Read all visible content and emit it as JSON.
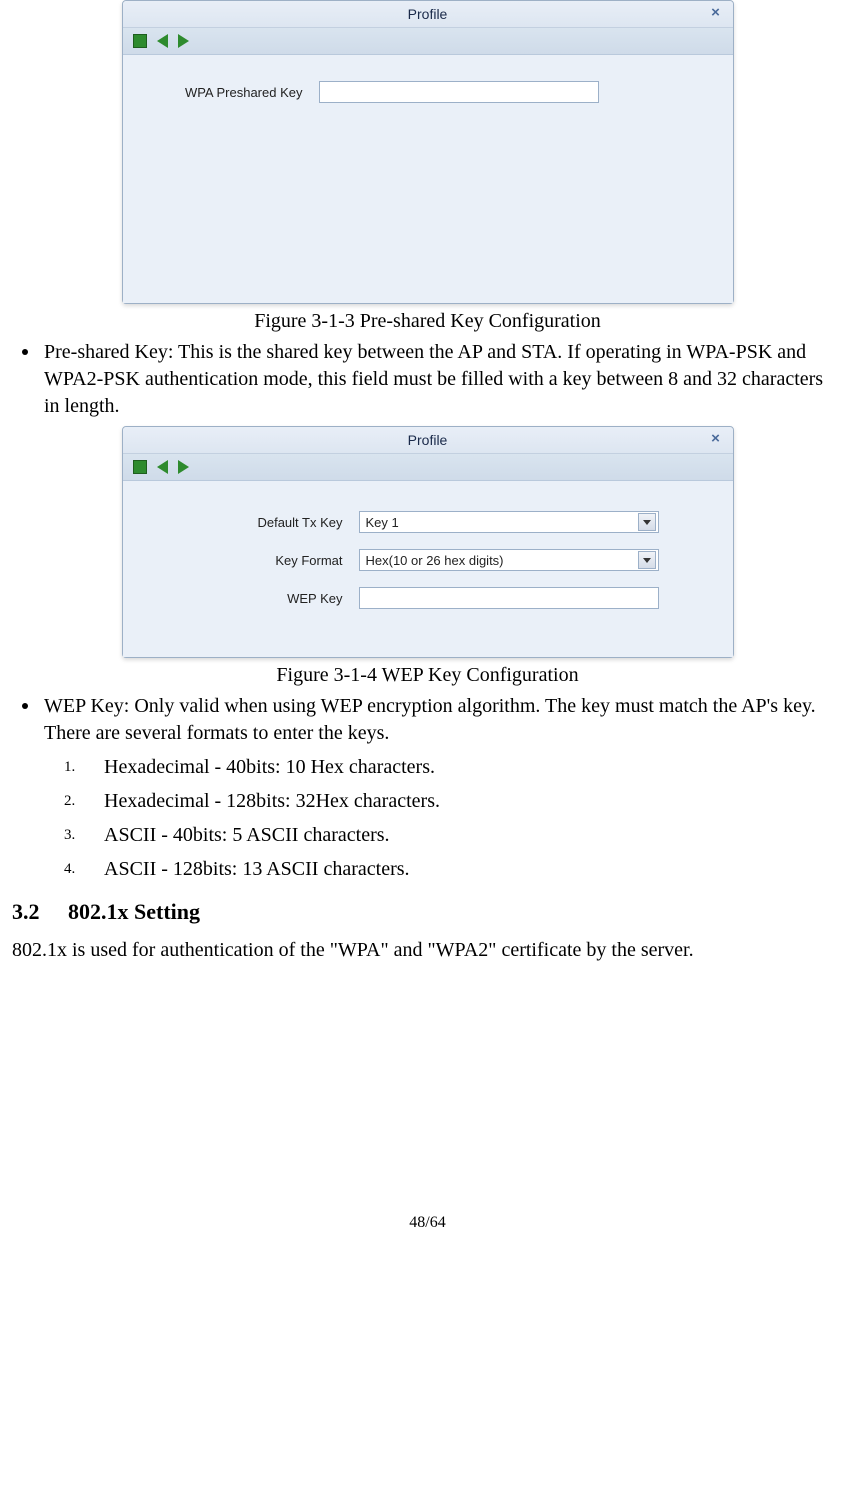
{
  "dialog1": {
    "title": "Profile",
    "field_label": "WPA Preshared Key",
    "field_value": ""
  },
  "caption1": "Figure 3-1-3 Pre-shared Key Configuration",
  "bullet1": "Pre-shared Key: This is the shared key between the AP and STA. If operating in WPA-PSK and WPA2-PSK authentication mode, this field must be filled with a key between 8 and 32 characters in length.",
  "dialog2": {
    "title": "Profile",
    "tx_label": "Default Tx Key",
    "tx_value": "Key 1",
    "fmt_label": "Key Format",
    "fmt_value": "Hex(10 or 26 hex digits)",
    "wep_label": "WEP Key",
    "wep_value": ""
  },
  "caption2": "Figure 3-1-4 WEP Key Configuration",
  "bullet2": "WEP Key: Only valid when using WEP encryption algorithm. The key must match the AP's key. There are several formats to enter the keys.",
  "list": {
    "i1": "Hexadecimal - 40bits: 10 Hex characters.",
    "i2": "Hexadecimal - 128bits: 32Hex characters.",
    "i3": "ASCII - 40bits: 5 ASCII characters.",
    "i4": "ASCII - 128bits: 13 ASCII characters."
  },
  "section": {
    "num": "3.2",
    "title": "802.1x Setting"
  },
  "para": "802.1x is used for authentication of the \"WPA\" and \"WPA2\" certificate by the server.",
  "footer": "48/64"
}
